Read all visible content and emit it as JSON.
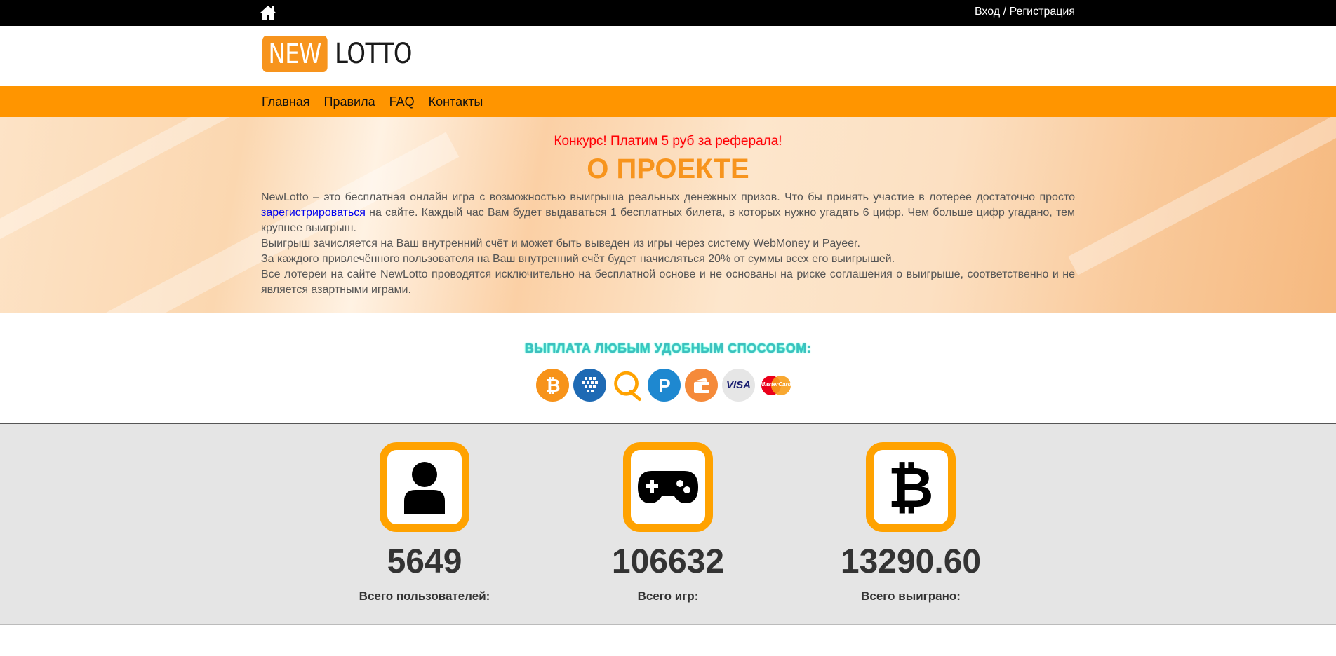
{
  "topbar": {
    "home_icon": "home-icon",
    "auth_label": "Вход / Регистрация"
  },
  "logo": {
    "part1": "NEW",
    "part2": "LOTTO",
    "accent_color": "#f7941d"
  },
  "nav": {
    "items": [
      {
        "label": "Главная"
      },
      {
        "label": "Правила"
      },
      {
        "label": "FAQ"
      },
      {
        "label": "Контакты"
      }
    ]
  },
  "about": {
    "promo": "Конкурс! Платим 5 руб за реферала!",
    "title": "О ПРОЕКТЕ",
    "p1_before": "NewLotto – это бесплатная онлайн игра с возможностью выигрыша реальных денежных призов. Что бы принять участие в лотерее достаточно просто ",
    "p1_link": "зарегистрироваться",
    "p1_after": " на сайте. Каждый час Вам будет выдаваться 1 бесплатных билета, в которых нужно угадать 6 цифр. Чем больше цифр угадано, тем крупнее выигрыш.",
    "p2": "Выигрыш зачисляется на Ваш внутренний счёт и может быть выведен из игры через систему WebMoney и Payeer.",
    "p3": "За каждого привлечённого пользователя на Ваш внутренний счёт будет начисляться 20% от суммы всех его выигрышей.",
    "p4": "Все лотереи на сайте NewLotto проводятся исключительно на бесплатной основе и не основаны на риске соглашения о выигрыше, соответственно и не является азартными играми."
  },
  "payout": {
    "title": "ВЫПЛАТА ЛЮБЫМ УДОБНЫМ СПОСОБОМ:",
    "methods": [
      {
        "icon": "bitcoin-icon"
      },
      {
        "icon": "webmoney-icon"
      },
      {
        "icon": "qiwi-icon"
      },
      {
        "icon": "payeer-icon"
      },
      {
        "icon": "yandex-money-icon"
      },
      {
        "icon": "visa-icon",
        "text": "VISA"
      },
      {
        "icon": "mastercard-icon",
        "text": "MasterCard"
      }
    ]
  },
  "stats": [
    {
      "icon": "user-icon",
      "value": "5649",
      "label": "Всего пользователей:"
    },
    {
      "icon": "gamepad-icon",
      "value": "106632",
      "label": "Всего игр:"
    },
    {
      "icon": "bitcoin-icon",
      "value": "13290.60",
      "label": "Всего выиграно:"
    }
  ]
}
